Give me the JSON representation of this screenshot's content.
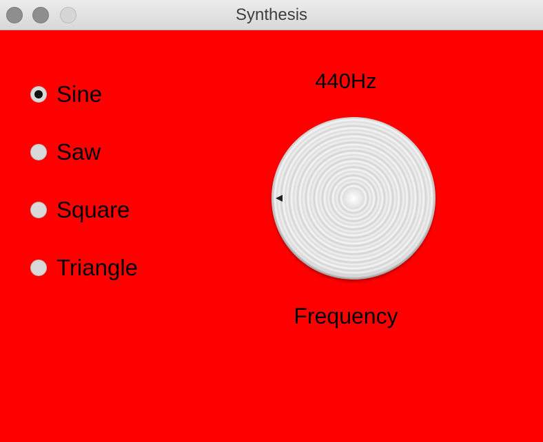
{
  "window": {
    "title": "Synthesis",
    "background_color": "#ff0000"
  },
  "waveform": {
    "options": [
      {
        "label": "Sine",
        "checked": true
      },
      {
        "label": "Saw",
        "checked": false
      },
      {
        "label": "Square",
        "checked": false
      },
      {
        "label": "Triangle",
        "checked": false
      }
    ]
  },
  "frequency": {
    "value_text": "440Hz",
    "label": "Frequency"
  }
}
